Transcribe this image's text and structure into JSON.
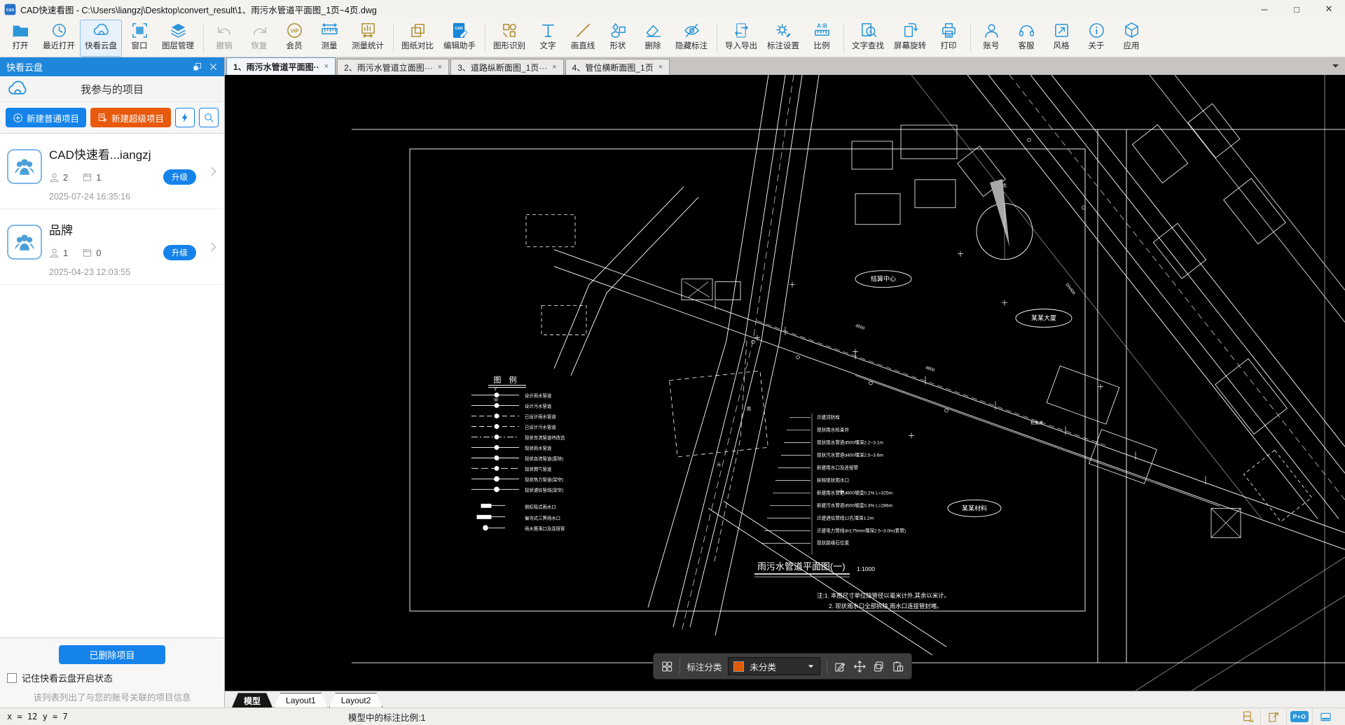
{
  "window": {
    "app_icon": "cadlogo",
    "title": "CAD快速看图 - C:\\Users\\liangzj\\Desktop\\convert_result\\1、雨污水管道平面图_1页~4页.dwg",
    "controls": [
      {
        "name": "minimize-button",
        "glyph": "─"
      },
      {
        "name": "maximize-button",
        "glyph": "□"
      },
      {
        "name": "close-button",
        "glyph": "✕"
      }
    ]
  },
  "toolbar": {
    "items": [
      {
        "label": "打开",
        "icon": "folder",
        "cls": ""
      },
      {
        "label": "最近打开",
        "icon": "recent",
        "cls": ""
      },
      {
        "label": "快看云盘",
        "icon": "cloud",
        "cls": "active"
      },
      {
        "label": "窗口",
        "icon": "window",
        "cls": ""
      },
      {
        "label": "图层管理",
        "icon": "layers",
        "cls": ""
      },
      {
        "label": "撤销",
        "icon": "undo",
        "cls": "disabled sep-before"
      },
      {
        "label": "恢复",
        "icon": "redo",
        "cls": "disabled"
      },
      {
        "label": "会员",
        "icon": "vip",
        "cls": "gold"
      },
      {
        "label": "测量",
        "icon": "ruler",
        "cls": ""
      },
      {
        "label": "测量统计",
        "icon": "stats",
        "cls": "gold"
      },
      {
        "label": "图纸对比",
        "icon": "compare",
        "cls": "gold sep-before"
      },
      {
        "label": "编辑助手",
        "icon": "edit-assist",
        "cls": ""
      },
      {
        "label": "图形识别",
        "icon": "shape-detect",
        "cls": "gold sep-before"
      },
      {
        "label": "文字",
        "icon": "text",
        "cls": ""
      },
      {
        "label": "画直线",
        "icon": "line",
        "cls": "gold"
      },
      {
        "label": "形状",
        "icon": "shapes",
        "cls": ""
      },
      {
        "label": "删除",
        "icon": "eraser",
        "cls": ""
      },
      {
        "label": "隐藏标注",
        "icon": "hide-note",
        "cls": ""
      },
      {
        "label": "导入导出",
        "icon": "import-export",
        "cls": "sep-before"
      },
      {
        "label": "标注设置",
        "icon": "note-settings",
        "cls": ""
      },
      {
        "label": "比例",
        "icon": "scale-ab",
        "cls": ""
      },
      {
        "label": "文字查找",
        "icon": "text-search",
        "cls": "sep-before"
      },
      {
        "label": "屏幕旋转",
        "icon": "rotate",
        "cls": ""
      },
      {
        "label": "打印",
        "icon": "print",
        "cls": ""
      },
      {
        "label": "账号",
        "icon": "account",
        "cls": "sep-before"
      },
      {
        "label": "客服",
        "icon": "support",
        "cls": ""
      },
      {
        "label": "风格",
        "icon": "style",
        "cls": ""
      },
      {
        "label": "关于",
        "icon": "about",
        "cls": ""
      },
      {
        "label": "应用",
        "icon": "apps",
        "cls": ""
      }
    ]
  },
  "doc_tabs": {
    "caret_icon": "caret",
    "items": [
      {
        "label": "1、雨污水管道平面图··",
        "close": "×",
        "cls": "active"
      },
      {
        "label": "2、雨污水管道立面图···",
        "close": "×",
        "cls": ""
      },
      {
        "label": "3、道路纵断面图_1页···",
        "close": "×",
        "cls": ""
      },
      {
        "label": "4、管位横断面图_1页",
        "close": "×",
        "cls": ""
      }
    ]
  },
  "sidebar": {
    "header": "快看云盘",
    "float_icon": "float",
    "close_icon": "closex",
    "cloud_icon": "cloud",
    "section_title": "我参与的项目",
    "new_normal": {
      "label": "新建普通项目",
      "icon": "plus-circle"
    },
    "new_super": {
      "label": "新建超级项目",
      "icon": "doc-plus"
    },
    "flash_icon": "lightning",
    "search_icon": "search",
    "meta": {
      "user_icon": "user-s",
      "file_icon": "file-s",
      "chev_icon": "chev",
      "avatar_icon": "people"
    },
    "projects": [
      {
        "title": "CAD快速看...iangzj",
        "members": "2",
        "files": "1",
        "badge": "升级",
        "date": "2025-07-24 16:35:16"
      },
      {
        "title": "品牌",
        "members": "1",
        "files": "0",
        "badge": "升级",
        "date": "2025-04-23 12:03:55"
      }
    ],
    "deleted_button": "已删除项目",
    "remember_checkbox": "记住快看云盘开启状态",
    "footer_note": "该列表列出了与您的账号关联的项目信息"
  },
  "annotation_bar": {
    "grid_icon": "grid4",
    "label": "标注分类",
    "selected": "未分类",
    "swatch_color": "#e05a00",
    "caret_icon": "caret",
    "edit_icon": "edit",
    "move_icon": "move",
    "copy_icon": "copy2",
    "paste_icon": "clip"
  },
  "layout_tabs": {
    "items": [
      {
        "label": "模型",
        "cls": "active"
      },
      {
        "label": "Layout1",
        "cls": ""
      },
      {
        "label": "Layout2",
        "cls": ""
      }
    ]
  },
  "status_bar": {
    "coords": "x = 12 y = 7",
    "scale_info": "模型中的标注比例:1",
    "pdf_icon": "pdf",
    "pdf_share_icon": "pdfshare",
    "po_badge": "P+O",
    "win_icon": "winmini"
  },
  "drawing": {
    "legend_title": "图  例",
    "legend": [
      "设计雨水管道",
      "设计污水管道",
      "已设计雨水管道",
      "已设计污水管道",
      "现状合流管道待改造",
      "现状雨水管道",
      "现状自流管道(废除)",
      "现状燃气管道",
      "现状热力管道(架空)",
      "现状通信管线(架空)",
      "倒虹吸式雨水口",
      "偏沟式三箅雨水口",
      "雨水篦落口及连接管"
    ],
    "specs": [
      "迁建消防栓",
      "现状雨水检查井",
      "现状雨水管道d500埋深2.2~3.1m",
      "现状污水管道d400埋深2.5~3.6m",
      "新建雨水口及连接管",
      "拆除现状雨水口",
      "新建雨水管道d800坡度0.2% L=325m",
      "新建污水管道d500坡度0.3% L=286m",
      "迁建通信管线12孔埋深1.2m",
      "迁建电力管线dn175mm埋深2.5~3.0m(套管)",
      "现状路缘石位置"
    ],
    "map_labels": [
      "结算中心",
      "某某大厦",
      "某某材料"
    ],
    "micro": [
      "Y",
      "W",
      "d500",
      "d800",
      "雨",
      "污",
      "DN400",
      "检查井"
    ],
    "title": "雨污水管道平面图(一)",
    "scale": "1:1000",
    "notes": [
      "注:1. 本图尺寸单位除管径以毫米计外,其余以米计。",
      "2. 现状雨水口全部拆除,雨水口连接管封堵。"
    ],
    "north_label": "北"
  },
  "colors": {
    "accent": "#1583e9",
    "orange": "#e8590c",
    "gold": "#b08e33",
    "header_blue": "#1e87dc",
    "canvas_bg": "#000000",
    "line": "#ffffff"
  }
}
